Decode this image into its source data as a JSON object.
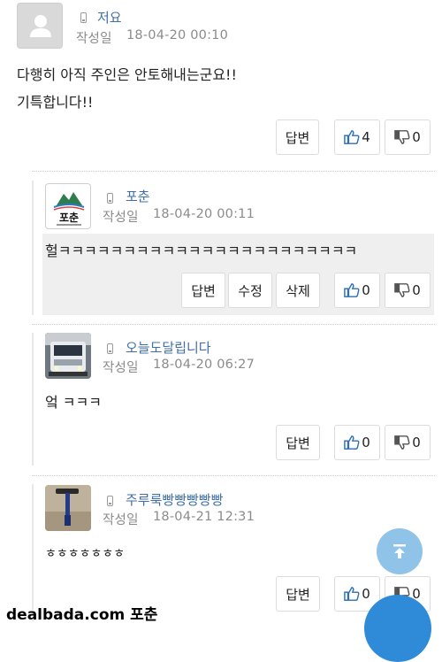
{
  "comments": [
    {
      "name": "저요",
      "date_label": "작성일",
      "date": "18-04-20 00:10",
      "lines": [
        "다행히 아직 주인은 안토해내는군요!!",
        "기특합니다!!"
      ],
      "reply_label": "답변",
      "like_count": "4",
      "dislike_count": "0"
    },
    {
      "name": "포춘",
      "avatar_text": "포춘",
      "date_label": "작성일",
      "date": "18-04-20 00:11",
      "text": "헐ㅋㅋㅋㅋㅋㅋㅋㅋㅋㅋㅋㅋㅋㅋㅋㅋㅋㅋㅋㅋㅋㅋㅋ",
      "reply_label": "답변",
      "edit_label": "수정",
      "delete_label": "삭제",
      "like_count": "0",
      "dislike_count": "0"
    },
    {
      "name": "오늘도달립니다",
      "date_label": "작성일",
      "date": "18-04-20 06:27",
      "text": "엌 ㅋㅋㅋ",
      "reply_label": "답변",
      "like_count": "0",
      "dislike_count": "0"
    },
    {
      "name": "주루룩빵빵빵빵빵",
      "date_label": "작성일",
      "date": "18-04-21 12:31",
      "text": "ㅎㅎㅎㅎㅎㅎㅎ",
      "reply_label": "답변",
      "like_count": "0",
      "dislike_count": "0"
    }
  ],
  "watermark": "dealbada.com 포춘",
  "colors": {
    "name": "#3f6fa8",
    "date": "#8b8b8b",
    "highlight": "#efefef",
    "fab": "#8fc3e8"
  },
  "icons": [
    "user-placeholder-icon",
    "mobile-icon",
    "thumbs-up-icon",
    "thumbs-down-icon",
    "scroll-top-icon"
  ]
}
